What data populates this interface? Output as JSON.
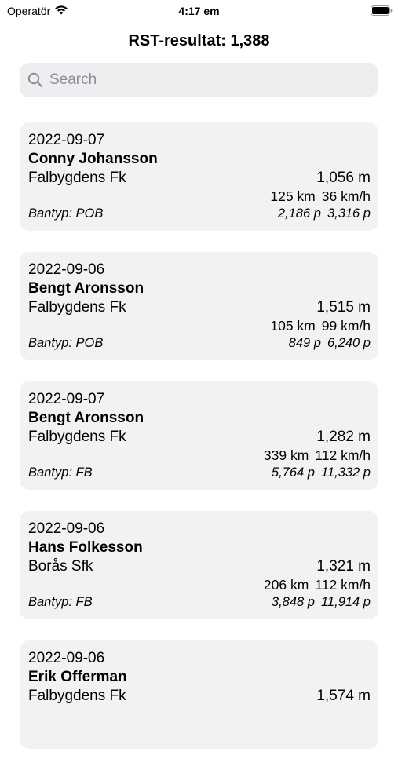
{
  "status_bar": {
    "carrier": "Operatör",
    "time": "4:17 em",
    "icons": [
      "wifi-icon",
      "battery-icon"
    ]
  },
  "nav": {
    "title": "RST-resultat: 1,388"
  },
  "search": {
    "placeholder": "Search",
    "value": ""
  },
  "results": [
    {
      "date": "2022-09-07",
      "name": "Conny Johansson",
      "club": "Falbygdens Fk",
      "distance_m": "1,056 m",
      "km": "125 km",
      "speed": "36 km/h",
      "bantyp": "Bantyp: POB",
      "p1": "2,186 p",
      "p2": "3,316 p"
    },
    {
      "date": "2022-09-06",
      "name": "Bengt Aronsson",
      "club": "Falbygdens Fk",
      "distance_m": "1,515 m",
      "km": "105 km",
      "speed": "99 km/h",
      "bantyp": "Bantyp: POB",
      "p1": "849 p",
      "p2": "6,240 p"
    },
    {
      "date": "2022-09-07",
      "name": "Bengt Aronsson",
      "club": "Falbygdens Fk",
      "distance_m": "1,282 m",
      "km": "339 km",
      "speed": "112 km/h",
      "bantyp": "Bantyp: FB",
      "p1": "5,764 p",
      "p2": "11,332 p"
    },
    {
      "date": "2022-09-06",
      "name": "Hans Folkesson",
      "club": "Borås Sfk",
      "distance_m": "1,321 m",
      "km": "206 km",
      "speed": "112 km/h",
      "bantyp": "Bantyp: FB",
      "p1": "3,848 p",
      "p2": "11,914 p"
    },
    {
      "date": "2022-09-06",
      "name": "Erik Offerman",
      "club": "Falbygdens Fk",
      "distance_m": "1,574 m",
      "km": "",
      "speed": "",
      "bantyp": "",
      "p1": "",
      "p2": ""
    }
  ]
}
